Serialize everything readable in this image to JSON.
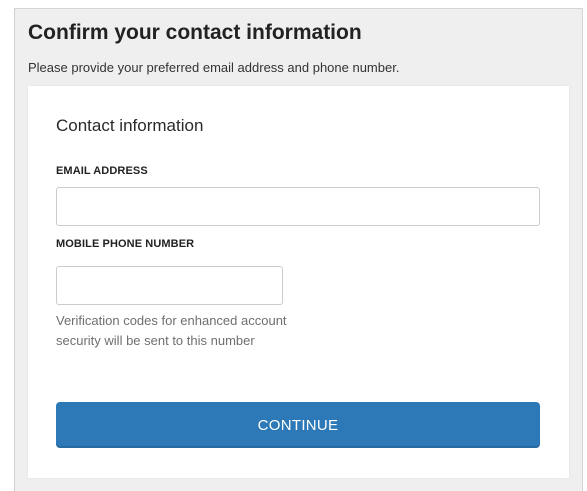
{
  "header": {
    "title": "Confirm your contact information",
    "subtitle": "Please provide your preferred email address and phone number."
  },
  "form": {
    "section_title": "Contact information",
    "email": {
      "label": "EMAIL ADDRESS",
      "value": "",
      "placeholder": ""
    },
    "phone": {
      "label": "MOBILE PHONE NUMBER",
      "value": "",
      "placeholder": "",
      "help_text": "Verification codes for enhanced account security will be sent to this number"
    },
    "continue_label": "CONTINUE"
  },
  "colors": {
    "primary_button": "#2d79b8",
    "page_background": "#efefef",
    "card_background": "#ffffff"
  }
}
